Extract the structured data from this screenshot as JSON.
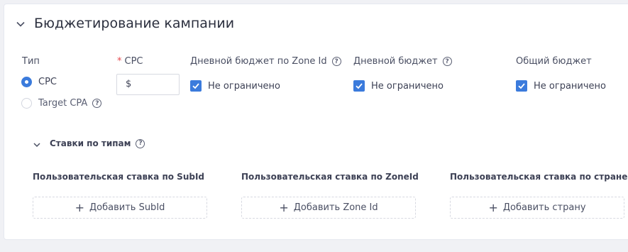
{
  "section": {
    "title": "Бюджетирование кампании"
  },
  "type_field": {
    "label": "Тип",
    "options": [
      {
        "label": "CPC",
        "selected": true
      },
      {
        "label": "Target CPA",
        "selected": false
      }
    ]
  },
  "cpc_field": {
    "required_mark": "*",
    "label": "CPC",
    "value": "$"
  },
  "budgets": [
    {
      "label": "Дневной бюджет по Zone Id",
      "checkbox_label": "Не ограничено",
      "checked": true
    },
    {
      "label": "Дневной бюджет",
      "checkbox_label": "Не ограничено",
      "checked": true
    },
    {
      "label": "Общий бюджет",
      "checkbox_label": "Не ограничено",
      "checked": true
    }
  ],
  "bids": {
    "title": "Ставки по типам",
    "columns": [
      {
        "title": "Пользовательская ставка по SubId",
        "button_label": "Добавить SubId"
      },
      {
        "title": "Пользовательская ставка по ZoneId",
        "button_label": "Добавить Zone Id"
      },
      {
        "title": "Пользовательская ставка по стране",
        "button_label": "Добавить страну"
      }
    ]
  },
  "colors": {
    "accent": "#3b7bdc",
    "required": "#e5484d",
    "background": "#f0f1f5"
  },
  "icons": {
    "collapse": "chevron-down-icon",
    "help": "help-circle-icon",
    "add": "plus-icon",
    "check": "check-icon"
  }
}
